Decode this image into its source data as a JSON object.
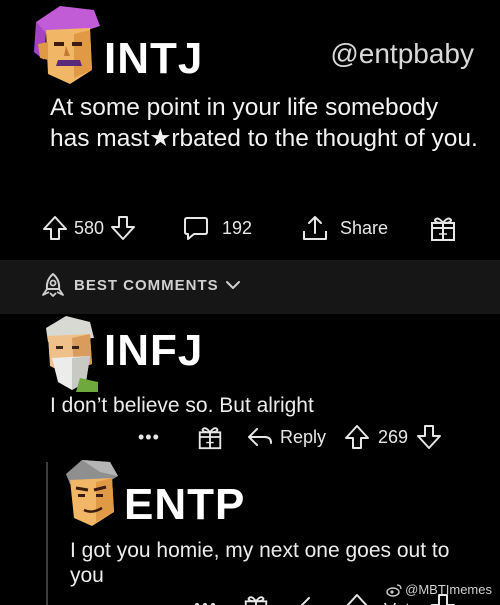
{
  "post": {
    "author": "INTJ",
    "handle": "@entpbaby",
    "text": "At some point in your life somebody has mast★rbated to the thought of you.",
    "upvotes": "580",
    "comments": "192",
    "share_label": "Share"
  },
  "best_comments_label": "BEST COMMENTS",
  "comments": [
    {
      "author": "INFJ",
      "text": "I don’t believe so. But alright",
      "more": "•••",
      "reply_label": "Reply",
      "upvotes": "269"
    },
    {
      "author": "ENTP",
      "text": "I got you homie, my next one goes out to you",
      "vote_label": "Vote"
    }
  ],
  "watermark": "@MBTImemes",
  "colors": {
    "background": "#000000",
    "band": "#161616",
    "text": "#f2f2f2",
    "intj_avatar": "#c25bd6",
    "skin": "#f2b766"
  }
}
